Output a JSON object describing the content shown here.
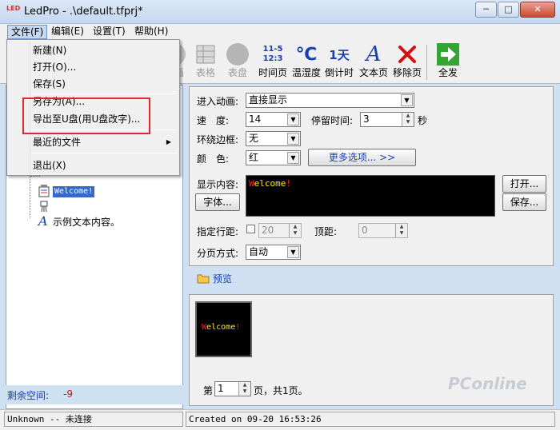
{
  "window": {
    "title": "LedPro - .\\default.tfprj*",
    "icon_text": "LED"
  },
  "menubar": {
    "file": "文件(F)",
    "edit": "编辑(E)",
    "settings": "设置(T)",
    "help": "帮助(H)"
  },
  "file_menu": {
    "new": "新建(N)",
    "open": "打开(O)...",
    "save": "保存(S)",
    "save_as": "另存为(A)...",
    "export_u": "导出至U盘(用U盘改字)...",
    "recent": "最近的文件",
    "exit": "退出(X)"
  },
  "toolbar": {
    "partial1": "画",
    "table": "表格",
    "clock": "表盘",
    "time_icon_top": "11-5",
    "time_icon_bottom": "12:3",
    "time": "时间页",
    "temp_icon": "℃",
    "temp": "温湿度",
    "countdown_icon": "1天",
    "countdown": "倒计时",
    "text_icon": "A",
    "text": "文本页",
    "remove": "移除页",
    "send_all": "全发"
  },
  "tree": {
    "item_welcome": "Welcome!",
    "item_sample": "示例文本内容。"
  },
  "left_panel": {
    "free_space_label": "剩余空间:",
    "free_space_value": "-9"
  },
  "props": {
    "enter_anim_label": "进入动画:",
    "enter_anim_value": "直接显示",
    "speed_label": "速　度:",
    "speed_value": "14",
    "stay_label": "停留时间:",
    "stay_value": "3",
    "stay_unit": "秒",
    "border_label": "环绕边框:",
    "border_value": "无",
    "color_label": "颜　色:",
    "color_value": "红",
    "more_options": "更多选项... >>",
    "content_label": "显示内容:",
    "content_text": "Welcome!",
    "font_btn": "字体...",
    "open_btn": "打开...",
    "save_btn": "保存...",
    "line_spacing_label": "指定行距:",
    "line_spacing_value": "20",
    "top_margin_label": "顶距:",
    "top_margin_value": "0",
    "paging_label": "分页方式:",
    "paging_value": "自动"
  },
  "preview": {
    "label": "预览",
    "led_text": "Welcome!",
    "page_prefix": "第",
    "page_value": "1",
    "page_suffix": "页，共1页。"
  },
  "statusbar": {
    "left": "Unknown -- 未连接",
    "right": "Created on 09-20 16:53:26"
  },
  "watermark": "PConline",
  "colors": {
    "led_red": "#ff2020",
    "led_yellow": "#ffee00",
    "highlight": "#e0262e",
    "accent": "#1a3fb0"
  }
}
